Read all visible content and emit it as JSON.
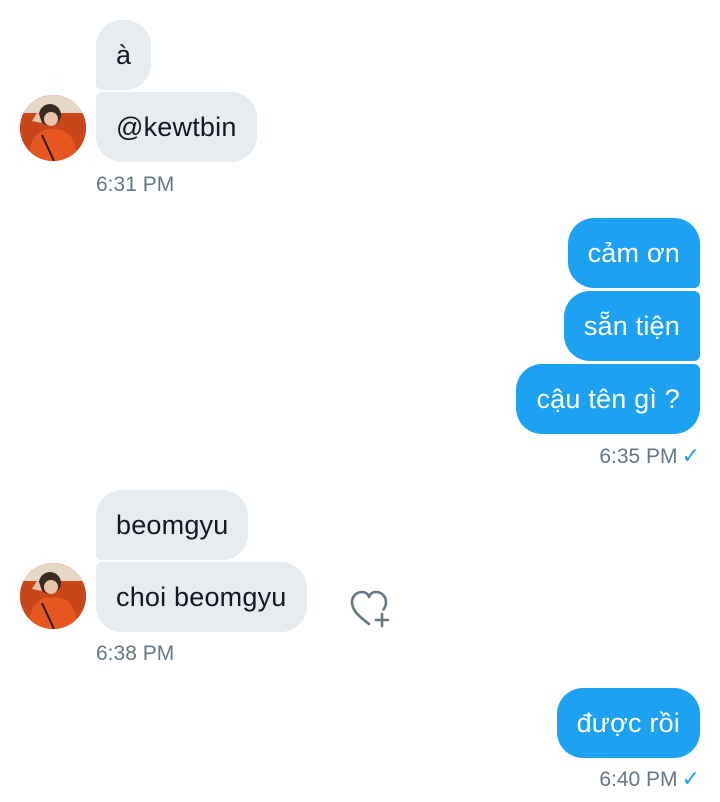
{
  "conversation": {
    "group1": {
      "messages": [
        "à",
        "@kewtbin"
      ],
      "time": "6:31 PM"
    },
    "group2": {
      "messages": [
        "cảm ơn",
        "sẵn tiện",
        "cậu tên gì ?"
      ],
      "time": "6:35 PM"
    },
    "group3": {
      "messages": [
        "beomgyu",
        "choi beomgyu"
      ],
      "time": "6:38 PM"
    },
    "group4": {
      "messages": [
        "được rồi"
      ],
      "time": "6:40 PM"
    },
    "read_check": "✓"
  },
  "colors": {
    "incoming_bubble": "#e6ecf0",
    "outgoing_bubble": "#1da1f2",
    "timestamp": "#657786",
    "accent": "#1da1f2"
  }
}
